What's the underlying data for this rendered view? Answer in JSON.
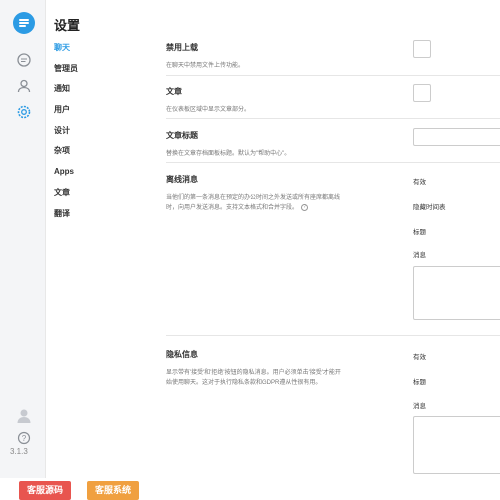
{
  "page": {
    "title": "设置"
  },
  "sidebar": {
    "version": "3.1.3",
    "icons": [
      "chat-logo-icon",
      "message-icon",
      "user-icon",
      "gear-icon",
      "avatar-icon",
      "help-icon"
    ]
  },
  "nav": {
    "items": [
      "聊天",
      "管理员",
      "通知",
      "用户",
      "设计",
      "杂项",
      "Apps",
      "文章",
      "翻译"
    ],
    "active": "聊天"
  },
  "settings": {
    "disable_upload": {
      "label": "禁用上载",
      "desc": "在聊天中禁用文件上传功能。"
    },
    "articles": {
      "label": "文章",
      "desc": "在仪表板区域中显示文章部分。"
    },
    "article_title": {
      "label": "文章标题",
      "desc": "替换在文章存档面板标题。默认为\"帮助中心\"。"
    },
    "offline": {
      "label": "离线消息",
      "desc": "当他们的第一条消息在预定的办公时间之外发送或所有座席都离线时，向用户发送消息。支持文本格式和合并字段。",
      "fields": [
        "有效",
        "隐藏时间表",
        "标题",
        "消息"
      ]
    },
    "privacy": {
      "label": "隐私信息",
      "desc": "显示带有'接受'和'拒绝'按钮的隐私消息。用户必须单击'接受'才能开始使用聊天。这对于执行隐私条款和GDPR遵从性很有用。",
      "fields": [
        "有效",
        "标题",
        "消息"
      ]
    }
  },
  "footer": {
    "btn1": {
      "label": "客服源码",
      "color": "#e8554f"
    },
    "btn2": {
      "label": "客服系统",
      "color": "#f0a040"
    }
  },
  "colors": {
    "accent": "#2c9be4"
  }
}
